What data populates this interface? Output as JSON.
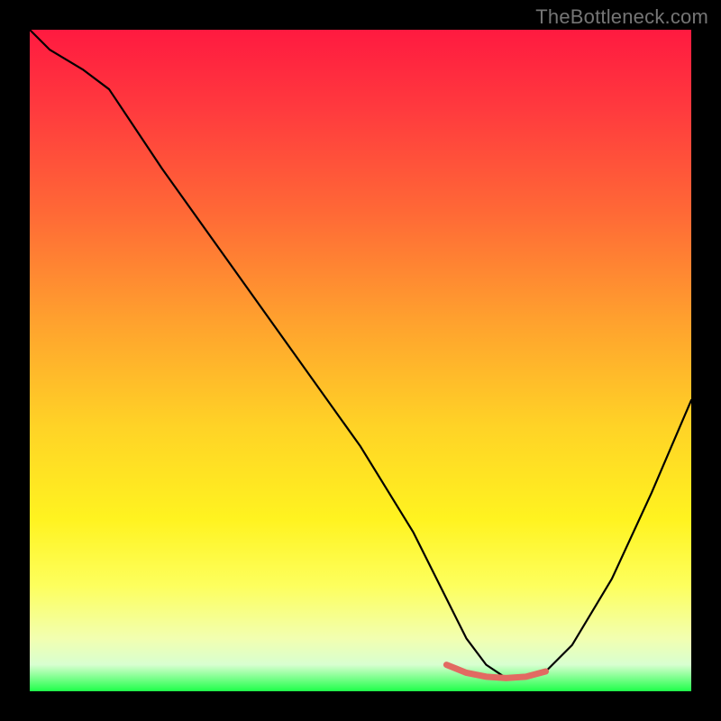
{
  "watermark": "TheBottleneck.com",
  "chart_data": {
    "type": "line",
    "title": "",
    "xlabel": "",
    "ylabel": "",
    "xlim": [
      0,
      100
    ],
    "ylim": [
      0,
      100
    ],
    "grid": false,
    "legend": false,
    "notes": "Plot region is a 734×734 px square inset in an 800×800 black frame. Background is a vertical heat gradient (red top → yellow mid → green bottom). A black V-shaped curve dips to a flat minimum near x≈70 with a short salmon highlight segment at the trough.",
    "series": [
      {
        "name": "curve",
        "color": "#000000",
        "x": [
          0,
          3,
          8,
          12,
          20,
          30,
          40,
          50,
          58,
          63,
          66,
          69,
          72,
          75,
          78,
          82,
          88,
          94,
          100
        ],
        "y": [
          100,
          97,
          94,
          91,
          79,
          65,
          51,
          37,
          24,
          14,
          8,
          4,
          2,
          2,
          3,
          7,
          17,
          30,
          44
        ]
      },
      {
        "name": "highlight",
        "color": "#e26a62",
        "x": [
          63,
          66,
          69,
          72,
          75,
          78
        ],
        "y": [
          4.0,
          2.8,
          2.2,
          2.0,
          2.2,
          3.0
        ]
      }
    ]
  }
}
